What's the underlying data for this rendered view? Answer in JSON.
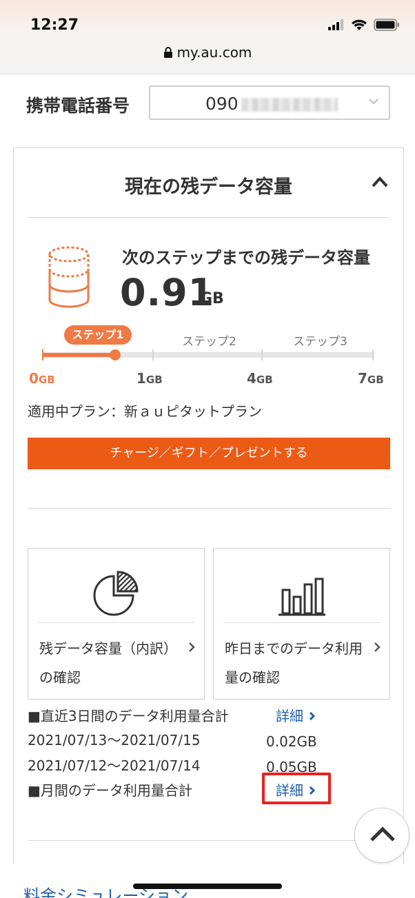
{
  "status_bar": {
    "time": "12:27"
  },
  "browser": {
    "url": "my.au.com"
  },
  "phone": {
    "label": "携帯電話番号",
    "value": "090"
  },
  "card": {
    "title": "現在の残データ容量",
    "next_step_label": "次のステップまでの残データ容量",
    "remaining_value": "0.91",
    "remaining_unit": "GB",
    "steps": {
      "active": "ステップ1",
      "step2": "ステップ2",
      "step3": "ステップ3"
    },
    "scale": [
      {
        "num": "0",
        "unit": "GB"
      },
      {
        "num": "1",
        "unit": "GB"
      },
      {
        "num": "4",
        "unit": "GB"
      },
      {
        "num": "7",
        "unit": "GB"
      }
    ],
    "plan_line": "適用中プラン：新ａｕピタットプラン",
    "charge_button": "チャージ／ギフト／プレゼントする",
    "tiles": [
      {
        "label": "残データ容量（内訳）の確認",
        "icon": "pie-chart-icon"
      },
      {
        "label": "昨日までのデータ利用量の確認",
        "icon": "bar-chart-icon"
      }
    ],
    "summary": {
      "recent_heading": "■直近3日間のデータ利用量合計",
      "recent_detail": "詳細",
      "rows": [
        {
          "range": "2021/07/13〜2021/07/15",
          "value": "0.02GB"
        },
        {
          "range": "2021/07/12〜2021/07/14",
          "value": "0.05GB"
        }
      ],
      "monthly_heading": "■月間のデータ利用量合計",
      "monthly_detail": "詳細"
    }
  },
  "footer": {
    "simulation_link": "料金シミュレーション"
  },
  "colors": {
    "accent": "#ec5b16",
    "accent_light": "#ef7a45",
    "link": "#1a5fa8",
    "highlight": "#e8231f"
  }
}
